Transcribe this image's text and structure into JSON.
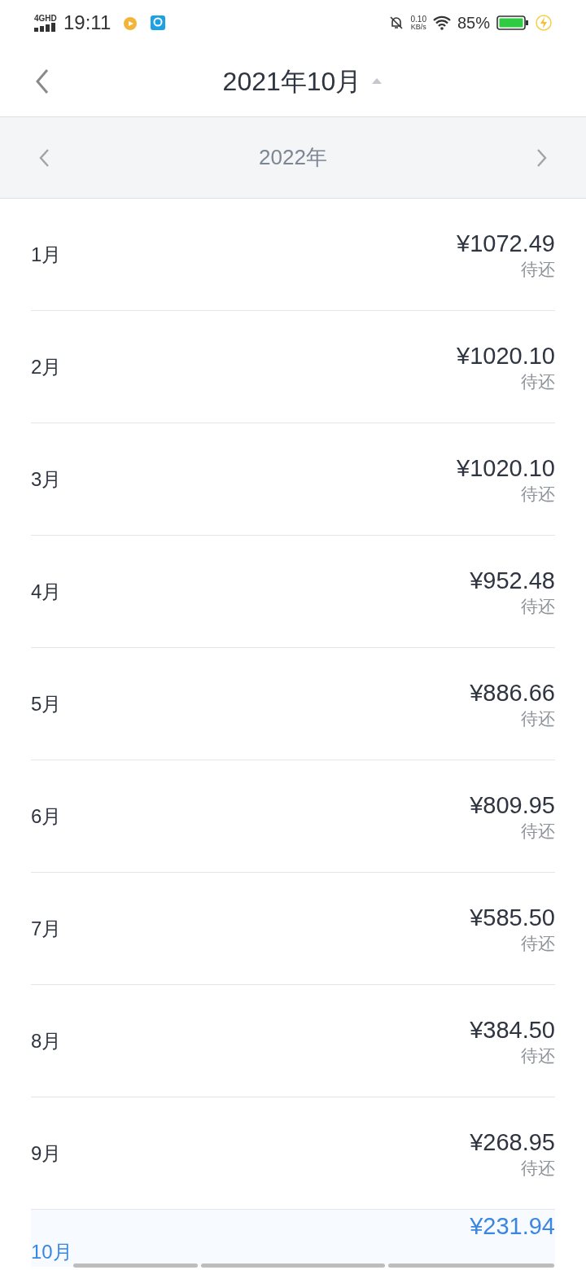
{
  "status_bar": {
    "network": "4GHD",
    "time": "19:11",
    "speed_value": "0.10",
    "speed_unit": "KB/s",
    "battery": "85%"
  },
  "header": {
    "title": "2021年10月",
    "dropdown_expanded": true
  },
  "year_bar": {
    "year": "2022年"
  },
  "months": [
    {
      "month": "1月",
      "amount": "¥1072.49",
      "status": "待还",
      "selected": false
    },
    {
      "month": "2月",
      "amount": "¥1020.10",
      "status": "待还",
      "selected": false
    },
    {
      "month": "3月",
      "amount": "¥1020.10",
      "status": "待还",
      "selected": false
    },
    {
      "month": "4月",
      "amount": "¥952.48",
      "status": "待还",
      "selected": false
    },
    {
      "month": "5月",
      "amount": "¥886.66",
      "status": "待还",
      "selected": false
    },
    {
      "month": "6月",
      "amount": "¥809.95",
      "status": "待还",
      "selected": false
    },
    {
      "month": "7月",
      "amount": "¥585.50",
      "status": "待还",
      "selected": false
    },
    {
      "month": "8月",
      "amount": "¥384.50",
      "status": "待还",
      "selected": false
    },
    {
      "month": "9月",
      "amount": "¥268.95",
      "status": "待还",
      "selected": false
    },
    {
      "month": "10月",
      "amount": "¥231.94",
      "selected": true
    }
  ]
}
